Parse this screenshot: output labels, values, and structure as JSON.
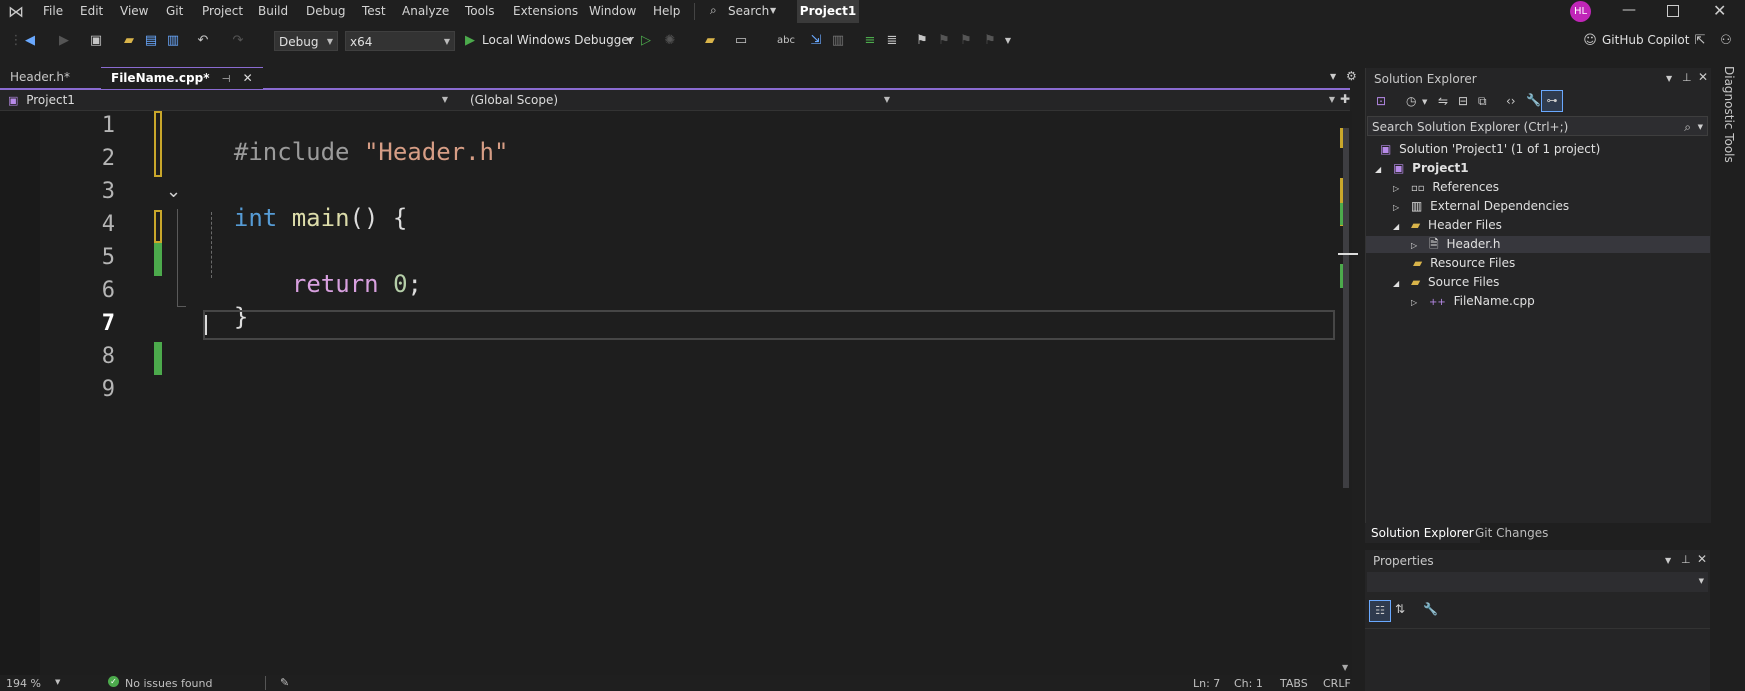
{
  "menu": {
    "items": [
      "File",
      "Edit",
      "View",
      "Git",
      "Project",
      "Build",
      "Debug",
      "Test",
      "Analyze",
      "Tools",
      "Extensions",
      "Window",
      "Help"
    ],
    "search_label": "Search",
    "project_label": "Project1",
    "avatar_initials": "HL",
    "copilot_label": "GitHub Copilot"
  },
  "toolbar": {
    "config_value": "Debug",
    "platform_value": "x64",
    "debugger_label": "Local Windows Debugger"
  },
  "tabs": [
    {
      "label": "Header.h*"
    },
    {
      "label": "FileName.cpp*"
    }
  ],
  "navbar": {
    "project_scope": "Project1",
    "global_scope": "(Global Scope)"
  },
  "editor": {
    "line_numbers": [
      "1",
      "2",
      "3",
      "4",
      "5",
      "6",
      "7",
      "8",
      "9"
    ],
    "code": {
      "include_directive": "#include",
      "include_file": "\"Header.h\"",
      "int_kw": "int",
      "main_fn": "main",
      "main_tail": "() {",
      "return_kw": "return",
      "return_val": "0",
      "semicolon": ";",
      "close_brace": "}"
    }
  },
  "status": {
    "zoom": "194 %",
    "issues": "No issues found",
    "line": "Ln: 7",
    "col": "Ch: 1",
    "tabs": "TABS",
    "eol": "CRLF"
  },
  "solution_explorer": {
    "title": "Solution Explorer",
    "search_placeholder": "Search Solution Explorer (Ctrl+;)",
    "tree": [
      {
        "label": "Solution 'Project1'  (1 of 1 project)"
      },
      {
        "label": "Project1"
      },
      {
        "label": "References"
      },
      {
        "label": "External Dependencies"
      },
      {
        "label": "Header Files"
      },
      {
        "label": "Header.h"
      },
      {
        "label": "Resource Files"
      },
      {
        "label": "Source Files"
      },
      {
        "label": "FileName.cpp"
      }
    ],
    "bottom_tabs": [
      "Solution Explorer",
      "Git Changes"
    ]
  },
  "properties": {
    "title": "Properties"
  },
  "diagnostic_tools": {
    "label": "Diagnostic Tools"
  },
  "colors": {
    "accent": "#8a6bd1",
    "change_saved": "#4caa4c",
    "change_unsaved": "#c9a72b",
    "avatar": "#c026b8"
  }
}
